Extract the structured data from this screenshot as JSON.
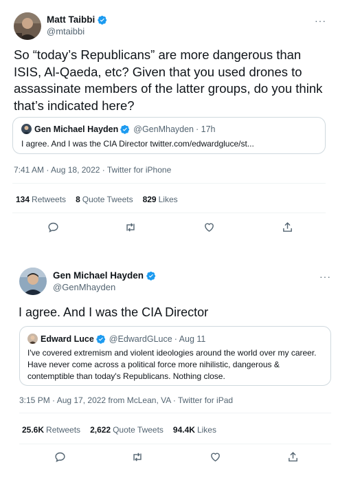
{
  "tweet1": {
    "author_name": "Matt Taibbi",
    "author_handle": "@mtaibbi",
    "more_label": "···",
    "text": "So “today’s Republicans” are more dangerous than ISIS, Al-Qaeda, etc? Given that you used drones to assassinate members of the latter groups, do you think that’s indicated here?",
    "quote": {
      "author_name": "Gen Michael Hayden",
      "author_handle": "@GenMhayden",
      "time": "· 17h",
      "text": "I agree.  And I was the CIA Director twitter.com/edwardgluce/st..."
    },
    "meta": "7:41 AM · Aug 18, 2022 · Twitter for iPhone",
    "stats": {
      "retweets_count": "134",
      "retweets_label": "Retweets",
      "quotes_count": "8",
      "quotes_label": "Quote Tweets",
      "likes_count": "829",
      "likes_label": "Likes"
    }
  },
  "tweet2": {
    "author_name": "Gen Michael Hayden",
    "author_handle": "@GenMhayden",
    "more_label": "···",
    "text": "I agree.  And I was the CIA Director",
    "quote": {
      "author_name": "Edward Luce",
      "author_handle": "@EdwardGLuce",
      "time": "· Aug 11",
      "text": "I've covered extremism and violent ideologies around the world over my career. Have never come across a political force more nihilistic, dangerous & contemptible than today's Republicans. Nothing close."
    },
    "meta": "3:15 PM · Aug 17, 2022 from McLean, VA · Twitter for iPad",
    "stats": {
      "retweets_count": "25.6K",
      "retweets_label": "Retweets",
      "quotes_count": "2,622",
      "quotes_label": "Quote Tweets",
      "likes_count": "94.4K",
      "likes_label": "Likes"
    }
  },
  "icons": [
    "reply-icon",
    "retweet-icon",
    "like-icon",
    "share-icon",
    "verified-icon"
  ],
  "colors": {
    "verified": "#1d9bf0",
    "muted": "#536471",
    "text": "#0f1419",
    "border": "#cfd9de"
  }
}
